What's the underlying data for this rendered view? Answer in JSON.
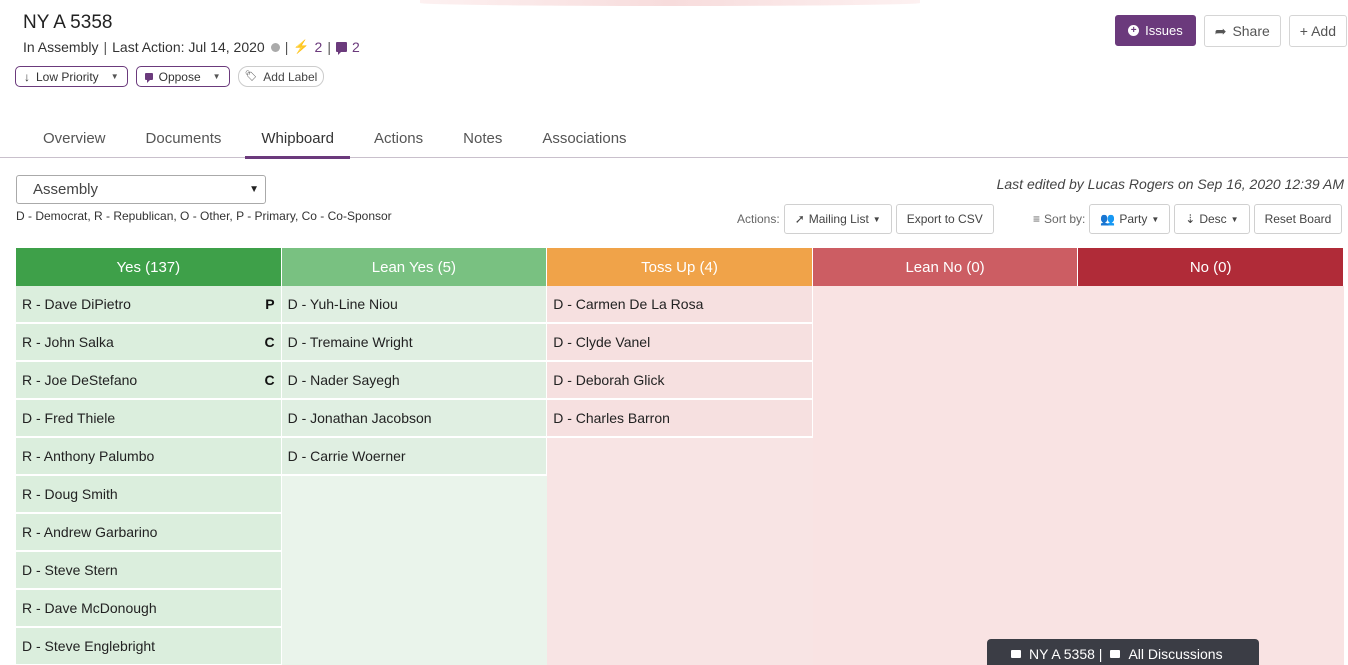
{
  "bill": {
    "title": "NY A 5358",
    "status": "In Assembly",
    "last_action": "Last Action: Jul 14, 2020",
    "bolt_count": "2",
    "comment_count": "2"
  },
  "pills": {
    "priority": "Low Priority",
    "position": "Oppose",
    "add_label": "Add Label"
  },
  "top_buttons": {
    "issues": "Issues",
    "share": "Share",
    "add": "+ Add"
  },
  "tabs": [
    {
      "label": "Overview"
    },
    {
      "label": "Documents"
    },
    {
      "label": "Whipboard"
    },
    {
      "label": "Actions"
    },
    {
      "label": "Notes"
    },
    {
      "label": "Associations"
    }
  ],
  "active_tab": "Whipboard",
  "chamber": "Assembly",
  "legend": "D - Democrat, R - Republican, O - Other, P - Primary, Co - Co-Sponsor",
  "last_edited": "Last edited by Lucas Rogers on Sep 16, 2020 12:39 AM",
  "toolbar": {
    "actions_label": "Actions:",
    "mailing_list": "Mailing List",
    "export_csv": "Export to CSV",
    "sort_label": "Sort by:",
    "sort_field": "Party",
    "sort_dir": "Desc",
    "reset": "Reset Board"
  },
  "columns": [
    {
      "title": "Yes (137)",
      "members": [
        {
          "name": "R - Dave DiPietro",
          "tag": "P"
        },
        {
          "name": "R - John Salka",
          "tag": "C"
        },
        {
          "name": "R - Joe DeStefano",
          "tag": "C"
        },
        {
          "name": "D - Fred Thiele",
          "tag": ""
        },
        {
          "name": "R - Anthony Palumbo",
          "tag": ""
        },
        {
          "name": "R - Doug Smith",
          "tag": ""
        },
        {
          "name": "R - Andrew Garbarino",
          "tag": ""
        },
        {
          "name": "D - Steve Stern",
          "tag": ""
        },
        {
          "name": "R - Dave McDonough",
          "tag": ""
        },
        {
          "name": "D - Steve Englebright",
          "tag": ""
        }
      ]
    },
    {
      "title": "Lean Yes (5)",
      "members": [
        {
          "name": "D - Yuh-Line Niou",
          "tag": ""
        },
        {
          "name": "D - Tremaine Wright",
          "tag": ""
        },
        {
          "name": "D - Nader Sayegh",
          "tag": ""
        },
        {
          "name": "D - Jonathan Jacobson",
          "tag": ""
        },
        {
          "name": "D - Carrie Woerner",
          "tag": ""
        }
      ]
    },
    {
      "title": "Toss Up (4)",
      "members": [
        {
          "name": "D - Carmen De La Rosa",
          "tag": ""
        },
        {
          "name": "D - Clyde Vanel",
          "tag": ""
        },
        {
          "name": "D - Deborah Glick",
          "tag": ""
        },
        {
          "name": "D - Charles Barron",
          "tag": ""
        }
      ]
    },
    {
      "title": "Lean No (0)",
      "members": []
    },
    {
      "title": "No (0)",
      "members": []
    }
  ],
  "discussion_bar": {
    "bill": "NY A 5358 |",
    "all": "All Discussions"
  },
  "colors": {
    "brand": "#6b3a7c",
    "yes": "#3ea049",
    "lean_yes": "#79c181",
    "toss_up": "#f0a349",
    "lean_no": "#cc5d63",
    "no": "#b02b38"
  }
}
